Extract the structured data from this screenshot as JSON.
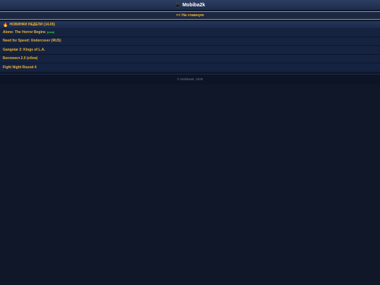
{
  "header": {
    "logo_icon": "phone-icon",
    "title": "Mobiba2k"
  },
  "nav": {
    "home_link": "<< На главную"
  },
  "section": {
    "icon": "fire-icon",
    "title": "НОВИНКИ НЕДЕЛИ (14.05)"
  },
  "items": [
    {
      "label": "Alone: The Horror Begins",
      "badge": "(new)"
    },
    {
      "label": "Need for Speed: Undercover (RUS)",
      "badge": ""
    },
    {
      "label": "Gangstar 2: Kings of L.A.",
      "badge": ""
    },
    {
      "label": "Беспонел 2.0 (обои)",
      "badge": ""
    },
    {
      "label": "Fight Night Round 4",
      "badge": ""
    }
  ],
  "footer": {
    "copyright": "© Mobiba2k, 2025"
  },
  "colors": {
    "background": "#0f1729",
    "accent": "#f2b530",
    "new_badge": "#37d84a"
  }
}
